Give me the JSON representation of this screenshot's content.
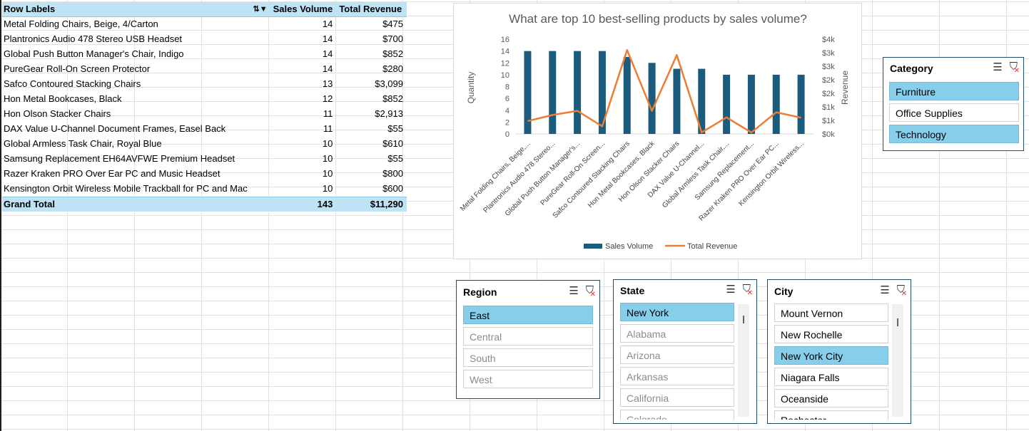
{
  "pivot": {
    "headers": {
      "row_labels": "Row Labels",
      "sales_volume": "Sales Volume",
      "total_revenue": "Total Revenue"
    },
    "rows": [
      {
        "label": "Metal Folding Chairs, Beige, 4/Carton",
        "volume": "14",
        "revenue": "$475"
      },
      {
        "label": "Plantronics Audio 478 Stereo USB Headset",
        "volume": "14",
        "revenue": "$700"
      },
      {
        "label": "Global Push Button Manager's Chair, Indigo",
        "volume": "14",
        "revenue": "$852"
      },
      {
        "label": "PureGear Roll-On Screen Protector",
        "volume": "14",
        "revenue": "$280"
      },
      {
        "label": "Safco Contoured Stacking Chairs",
        "volume": "13",
        "revenue": "$3,099"
      },
      {
        "label": "Hon Metal Bookcases, Black",
        "volume": "12",
        "revenue": "$852"
      },
      {
        "label": "Hon Olson Stacker Chairs",
        "volume": "11",
        "revenue": "$2,913"
      },
      {
        "label": "DAX Value U-Channel Document Frames, Easel Back",
        "volume": "11",
        "revenue": "$55"
      },
      {
        "label": "Global Armless Task Chair, Royal Blue",
        "volume": "10",
        "revenue": "$610"
      },
      {
        "label": "Samsung Replacement EH64AVFWE Premium Headset",
        "volume": "10",
        "revenue": "$55"
      },
      {
        "label": "Razer Kraken PRO Over Ear PC and Music Headset",
        "volume": "10",
        "revenue": "$800"
      },
      {
        "label": "Kensington Orbit Wireless Mobile Trackball for PC and Mac",
        "volume": "10",
        "revenue": "$600"
      }
    ],
    "total": {
      "label": "Grand Total",
      "volume": "143",
      "revenue": "$11,290"
    }
  },
  "chart_data": {
    "type": "bar",
    "title": "What are top 10 best-selling products by sales volume?",
    "ylabel": "Quantity",
    "y2label": "Revenue",
    "ylim": [
      0,
      16
    ],
    "y_ticks": [
      "0",
      "2",
      "4",
      "6",
      "8",
      "10",
      "12",
      "14",
      "16"
    ],
    "y2_ticks": [
      "$0k",
      "$1k",
      "$1k",
      "$2k",
      "$2k",
      "$3k",
      "$3k",
      "$4k"
    ],
    "y2lim": [
      0,
      3500
    ],
    "categories": [
      "Metal Folding Chairs, Beige,...",
      "Plantronics Audio 478 Stereo...",
      "Global Push Button Manager's...",
      "PureGear Roll-On Screen...",
      "Safco Contoured Stacking Chairs",
      "Hon Metal Bookcases, Black",
      "Hon Olson Stacker Chairs",
      "DAX Value U-Channel...",
      "Global Armless Task Chair,...",
      "Samsung Replacement...",
      "Razer Kraken PRO Over Ear PC...",
      "Kensington Orbit Wireless..."
    ],
    "series": [
      {
        "name": "Sales Volume",
        "type": "bar",
        "color": "#1b5c7e",
        "values": [
          14,
          14,
          14,
          14,
          13,
          12,
          11,
          11,
          10,
          10,
          10,
          10
        ]
      },
      {
        "name": "Total Revenue",
        "type": "line",
        "axis": "secondary",
        "color": "#ed7d31",
        "values": [
          475,
          700,
          852,
          280,
          3099,
          852,
          2913,
          55,
          610,
          55,
          800,
          600
        ]
      }
    ],
    "legend": "bottom"
  },
  "slicers": {
    "category": {
      "title": "Category",
      "items": [
        {
          "label": "Furniture",
          "state": "selected"
        },
        {
          "label": "Office Supplies",
          "state": "normal"
        },
        {
          "label": "Technology",
          "state": "selected"
        }
      ]
    },
    "region": {
      "title": "Region",
      "items": [
        {
          "label": "East",
          "state": "selected"
        },
        {
          "label": "Central",
          "state": "dim"
        },
        {
          "label": "South",
          "state": "dim"
        },
        {
          "label": "West",
          "state": "dim"
        }
      ]
    },
    "state": {
      "title": "State",
      "items": [
        {
          "label": "New York",
          "state": "selected"
        },
        {
          "label": "Alabama",
          "state": "dim"
        },
        {
          "label": "Arizona",
          "state": "dim"
        },
        {
          "label": "Arkansas",
          "state": "dim"
        },
        {
          "label": "California",
          "state": "dim"
        },
        {
          "label": "Colorado",
          "state": "dim"
        }
      ]
    },
    "city": {
      "title": "City",
      "items": [
        {
          "label": "Mount Vernon",
          "state": "normal"
        },
        {
          "label": "New Rochelle",
          "state": "normal"
        },
        {
          "label": "New York City",
          "state": "selected"
        },
        {
          "label": "Niagara Falls",
          "state": "normal"
        },
        {
          "label": "Oceanside",
          "state": "normal"
        },
        {
          "label": "Rochester",
          "state": "normal"
        }
      ]
    }
  },
  "icons": {
    "multi_select": "multi-select-icon",
    "clear_filter": "clear-filter-icon",
    "sort_filter": "sort-filter-icon"
  }
}
